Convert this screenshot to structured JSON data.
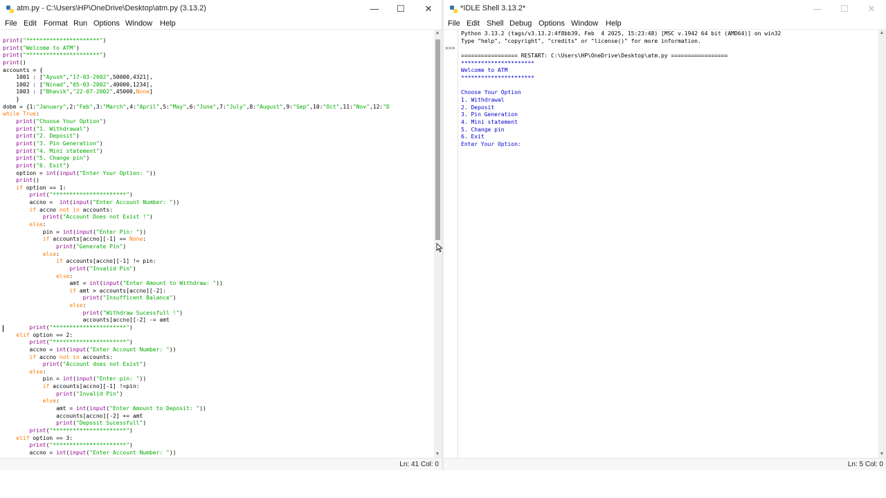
{
  "editor": {
    "title": "atm.py - C:\\Users\\HP\\OneDrive\\Desktop\\atm.py (3.13.2)",
    "menu": [
      "File",
      "Edit",
      "Format",
      "Run",
      "Options",
      "Window",
      "Help"
    ],
    "status": "Ln: 41    Col: 0",
    "lines": [
      "print(\"**********************\")",
      "print(\"Welcome to ATM\")",
      "print(\"**********************\")",
      "print()",
      "accounts = {",
      "    1001 : [\"Ayush\",\"17-03-2002\",50000,4321],",
      "    1002 : [\"Ninad\",\"05-03-2002\",40000,1234],",
      "    1003 : [\"Bhavik\",\"22-07-2002\",45000,None]",
      "    }",
      "dobm = {1:\"January\",2:\"Feb\",3:\"March\",4:\"April\",5:\"May\",6:\"June\",7:\"July\",8:\"August\",9:\"Sep\",10:\"Oct\",11:\"Nov\",12:\"D",
      "while True:",
      "    print(\"Choose Your Option\")",
      "    print(\"1. Withdrawal\")",
      "    print(\"2. Deposit\")",
      "    print(\"3. Pin Generation\")",
      "    print(\"4. Mini statement\")",
      "    print(\"5. Change pin\")",
      "    print(\"6. Exit\")",
      "    option = int(input(\"Enter Your Option: \"))",
      "    print()",
      "    if option == 1:",
      "        print(\"**********************\")",
      "        accno =  int(input(\"Enter Account Number: \"))",
      "        if accno not in accounts:",
      "            print(\"Account Does not Exist !\")",
      "        else:",
      "            pin = int(input(\"Enter Pin: \"))",
      "            if accounts[accno][-1] == None:",
      "                print(\"Generate Pin\")",
      "            else:",
      "                if accounts[accno][-1] != pin:",
      "                    print(\"Invalid Pin\")",
      "                else:",
      "                    amt = int(input(\"Enter Amount to Withdraw: \"))",
      "                    if amt > accounts[accno][-2]:",
      "                        print(\"Insufficent Balance\")",
      "                    else:",
      "                        print(\"Withdraw Sucessfull !\")",
      "                        accounts[accno][-2] -= amt",
      "        print(\"**********************\")",
      "    elif option == 2:",
      "        print(\"**********************\")",
      "        accno = int(input(\"Enter Account Number: \"))",
      "        if accno not in accounts:",
      "            print(\"Account does not Exist\")",
      "        else:",
      "            pin = int(input(\"Enter pin: \"))",
      "            if accounts[accno][-1] !=pin:",
      "                print(\"Invalid Pin\")",
      "            else:",
      "                amt = int(input(\"Enter Amount to Deposit: \"))",
      "                accounts[accno][-2] += amt",
      "                print(\"Deposit Sucessfull\")",
      "        print(\"**********************\")",
      "    elif option == 3:",
      "        print(\"**********************\")",
      "        accno = int(input(\"Enter Account Number: \"))"
    ]
  },
  "shell": {
    "title": "*IDLE Shell 3.13.2*",
    "menu": [
      "File",
      "Edit",
      "Shell",
      "Debug",
      "Options",
      "Window",
      "Help"
    ],
    "prompt": ">>>",
    "status": "Ln: 5    Col: 0",
    "header_lines": [
      "Python 3.13.2 (tags/v3.13.2:4f8bb39, Feb  4 2025, 15:23:48) [MSC v.1942 64 bit (AMD64)] on win32",
      "Type \"help\", \"copyright\", \"credits\" or \"license()\" for more information."
    ],
    "restart_line": "================= RESTART: C:\\Users\\HP\\OneDrive\\Desktop\\atm.py =================",
    "output_lines": [
      "**********************",
      "Welcome to ATM",
      "**********************",
      "",
      "Choose Your Option",
      "1. Withdrawal",
      "2. Deposit",
      "3. Pin Generation",
      "4. Mini statement",
      "5. Change pin",
      "6. Exit",
      "Enter Your Option: "
    ]
  },
  "colors": {
    "keyword": "#ff7700",
    "string": "#00aa00",
    "builtin": "#900090",
    "output": "#0000cc"
  }
}
